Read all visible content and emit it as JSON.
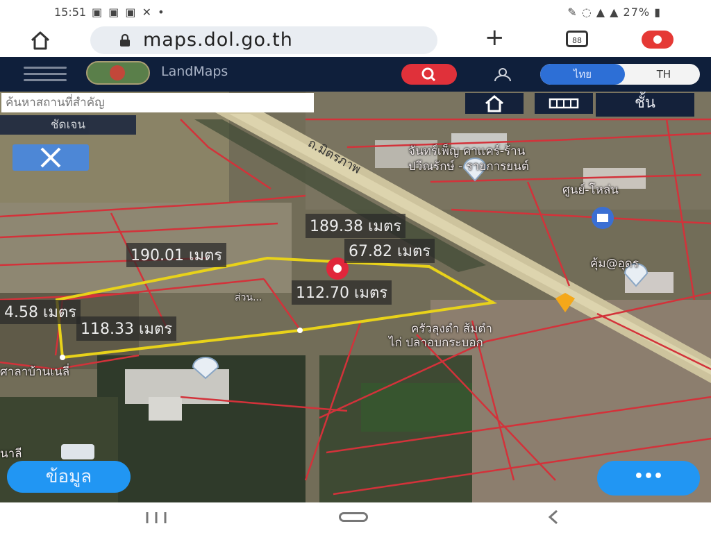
{
  "status_bar": {
    "time": "15:51",
    "left_icons": "▣ ▣ ▣ ✕  •",
    "right_text": "✎ ◌ ▲ ▲ 27% ▮"
  },
  "browser": {
    "url": "maps.dol.go.th",
    "plus": "+",
    "tabs_count": "88"
  },
  "app": {
    "brand": "LandMaps",
    "lang_active": "ไทย",
    "lang_inactive": "TH",
    "search_placeholder": "ค้นหาสถานที่สำคัญ",
    "measure_label": "ชัดเจน",
    "layer_label": "ชั้น"
  },
  "map": {
    "road_name": "ถ.มิตรภาพ",
    "measurements": {
      "m1": "189.38 เมตร",
      "m2": "190.01 เมตร",
      "m3": "67.82 เมตร",
      "m4": "112.70 เมตร",
      "m5": "4.58 เมตร",
      "m6": "118.33 เมตร"
    },
    "poi": {
      "p1": "จันทร์เพ็ญ คาเเคร์-ร้าน",
      "p2": "ปวีณรักษ์ - รายการยนต์",
      "p3": "ศูนย์-โหล่น",
      "p4": "คุ้ม@อุดร",
      "p5": "ครัวลุงดำ ส้มตำ",
      "p6": "ไก่ ปลาอบกระบอก",
      "p7": "ศาลาบ้านเนลี่",
      "p8": "ส่วน...",
      "p9": "นาลี"
    },
    "info_button": "ข้อมูล",
    "more_button": "•••"
  },
  "colors": {
    "appbar": "#0f1f3b",
    "accent_blue": "#2196f3",
    "search_red": "#e0313a",
    "parcel_yellow": "#e8d21a",
    "boundary_red": "#d3323a"
  },
  "icons": {
    "home": "home-icon",
    "lock": "lock-icon",
    "search": "search-icon",
    "user": "user-icon",
    "close": "close-icon",
    "pin": "map-pin-icon"
  }
}
